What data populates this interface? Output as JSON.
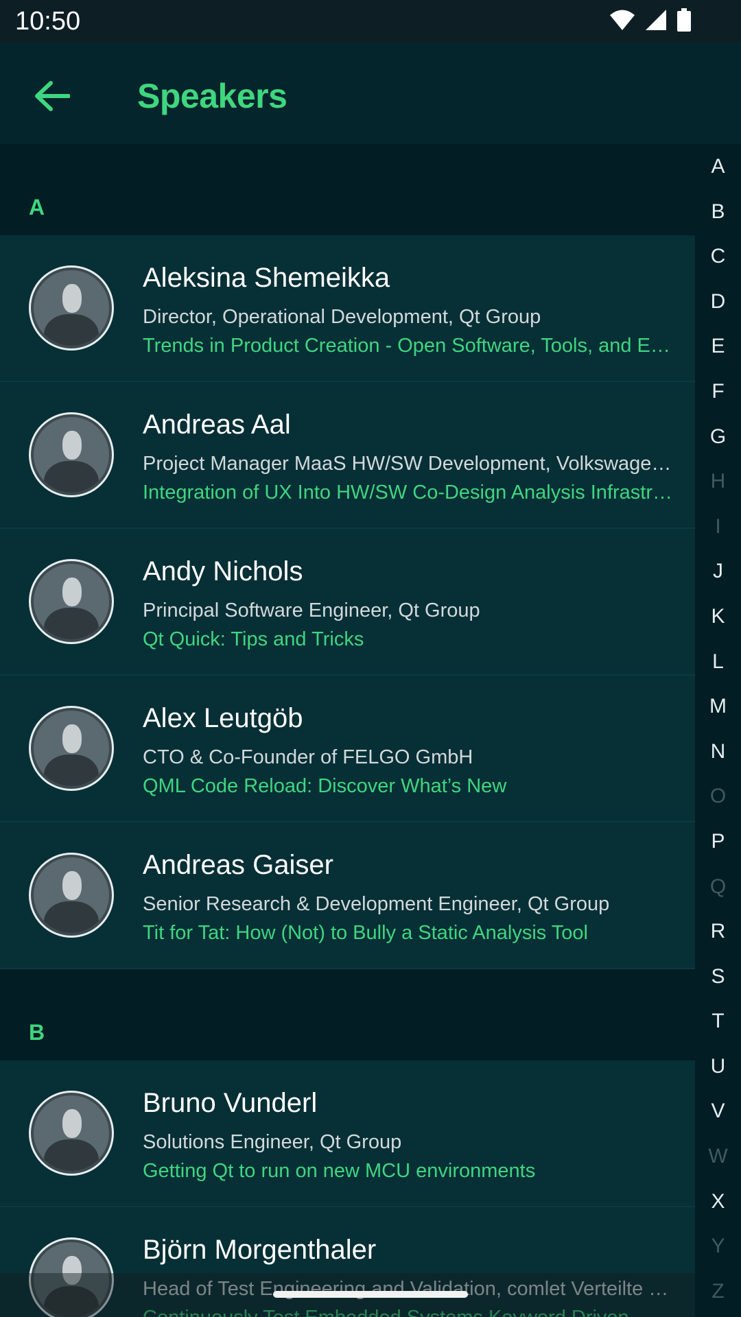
{
  "status_bar": {
    "time": "10:50",
    "icons": [
      "wifi-icon",
      "signal-icon",
      "battery-icon"
    ]
  },
  "app_bar": {
    "title": "Speakers",
    "back_icon": "arrow-left-icon"
  },
  "colors": {
    "accent": "#3fd67f",
    "background": "#031d24",
    "row_background": "#072f36"
  },
  "sections": [
    {
      "letter": "A",
      "speakers": [
        {
          "name": "Aleksina Shemeikka",
          "role": "Director, Operational Development, Qt Group",
          "talk": "Trends in Product Creation - Open Software, Tools, and Ecosystems"
        },
        {
          "name": "Andreas Aal",
          "role": "Project Manager MaaS HW/SW Development, Volkswagen AG",
          "talk": "Integration of UX Into HW/SW Co-Design Analysis Infrastructure"
        },
        {
          "name": "Andy Nichols",
          "role": "Principal Software Engineer, Qt Group",
          "talk": "Qt Quick: Tips and Tricks"
        },
        {
          "name": "Alex Leutgöb",
          "role": "CTO & Co-Founder of FELGO GmbH",
          "talk": "QML Code Reload: Discover What’s New"
        },
        {
          "name": "Andreas Gaiser",
          "role": "Senior Research & Development Engineer, Qt Group",
          "talk": "Tit for Tat: How (Not) to Bully a Static Analysis Tool"
        }
      ]
    },
    {
      "letter": "B",
      "speakers": [
        {
          "name": "Bruno Vunderl",
          "role": "Solutions Engineer, Qt Group",
          "talk": "Getting Qt to run on new MCU environments"
        },
        {
          "name": "Björn Morgenthaler",
          "role": "Head of Test Engineering and Validation, comlet Verteilte Systeme GmbH",
          "talk": "Continuously Test Embedded Systems Keyword Driven"
        }
      ]
    }
  ],
  "index_bar": [
    {
      "letter": "A",
      "enabled": true
    },
    {
      "letter": "B",
      "enabled": true
    },
    {
      "letter": "C",
      "enabled": true
    },
    {
      "letter": "D",
      "enabled": true
    },
    {
      "letter": "E",
      "enabled": true
    },
    {
      "letter": "F",
      "enabled": true
    },
    {
      "letter": "G",
      "enabled": true
    },
    {
      "letter": "H",
      "enabled": false
    },
    {
      "letter": "I",
      "enabled": false
    },
    {
      "letter": "J",
      "enabled": true
    },
    {
      "letter": "K",
      "enabled": true
    },
    {
      "letter": "L",
      "enabled": true
    },
    {
      "letter": "M",
      "enabled": true
    },
    {
      "letter": "N",
      "enabled": true
    },
    {
      "letter": "O",
      "enabled": false
    },
    {
      "letter": "P",
      "enabled": true
    },
    {
      "letter": "Q",
      "enabled": false
    },
    {
      "letter": "R",
      "enabled": true
    },
    {
      "letter": "S",
      "enabled": true
    },
    {
      "letter": "T",
      "enabled": true
    },
    {
      "letter": "U",
      "enabled": true
    },
    {
      "letter": "V",
      "enabled": true
    },
    {
      "letter": "W",
      "enabled": false
    },
    {
      "letter": "X",
      "enabled": true
    },
    {
      "letter": "Y",
      "enabled": false
    },
    {
      "letter": "Z",
      "enabled": false
    }
  ]
}
